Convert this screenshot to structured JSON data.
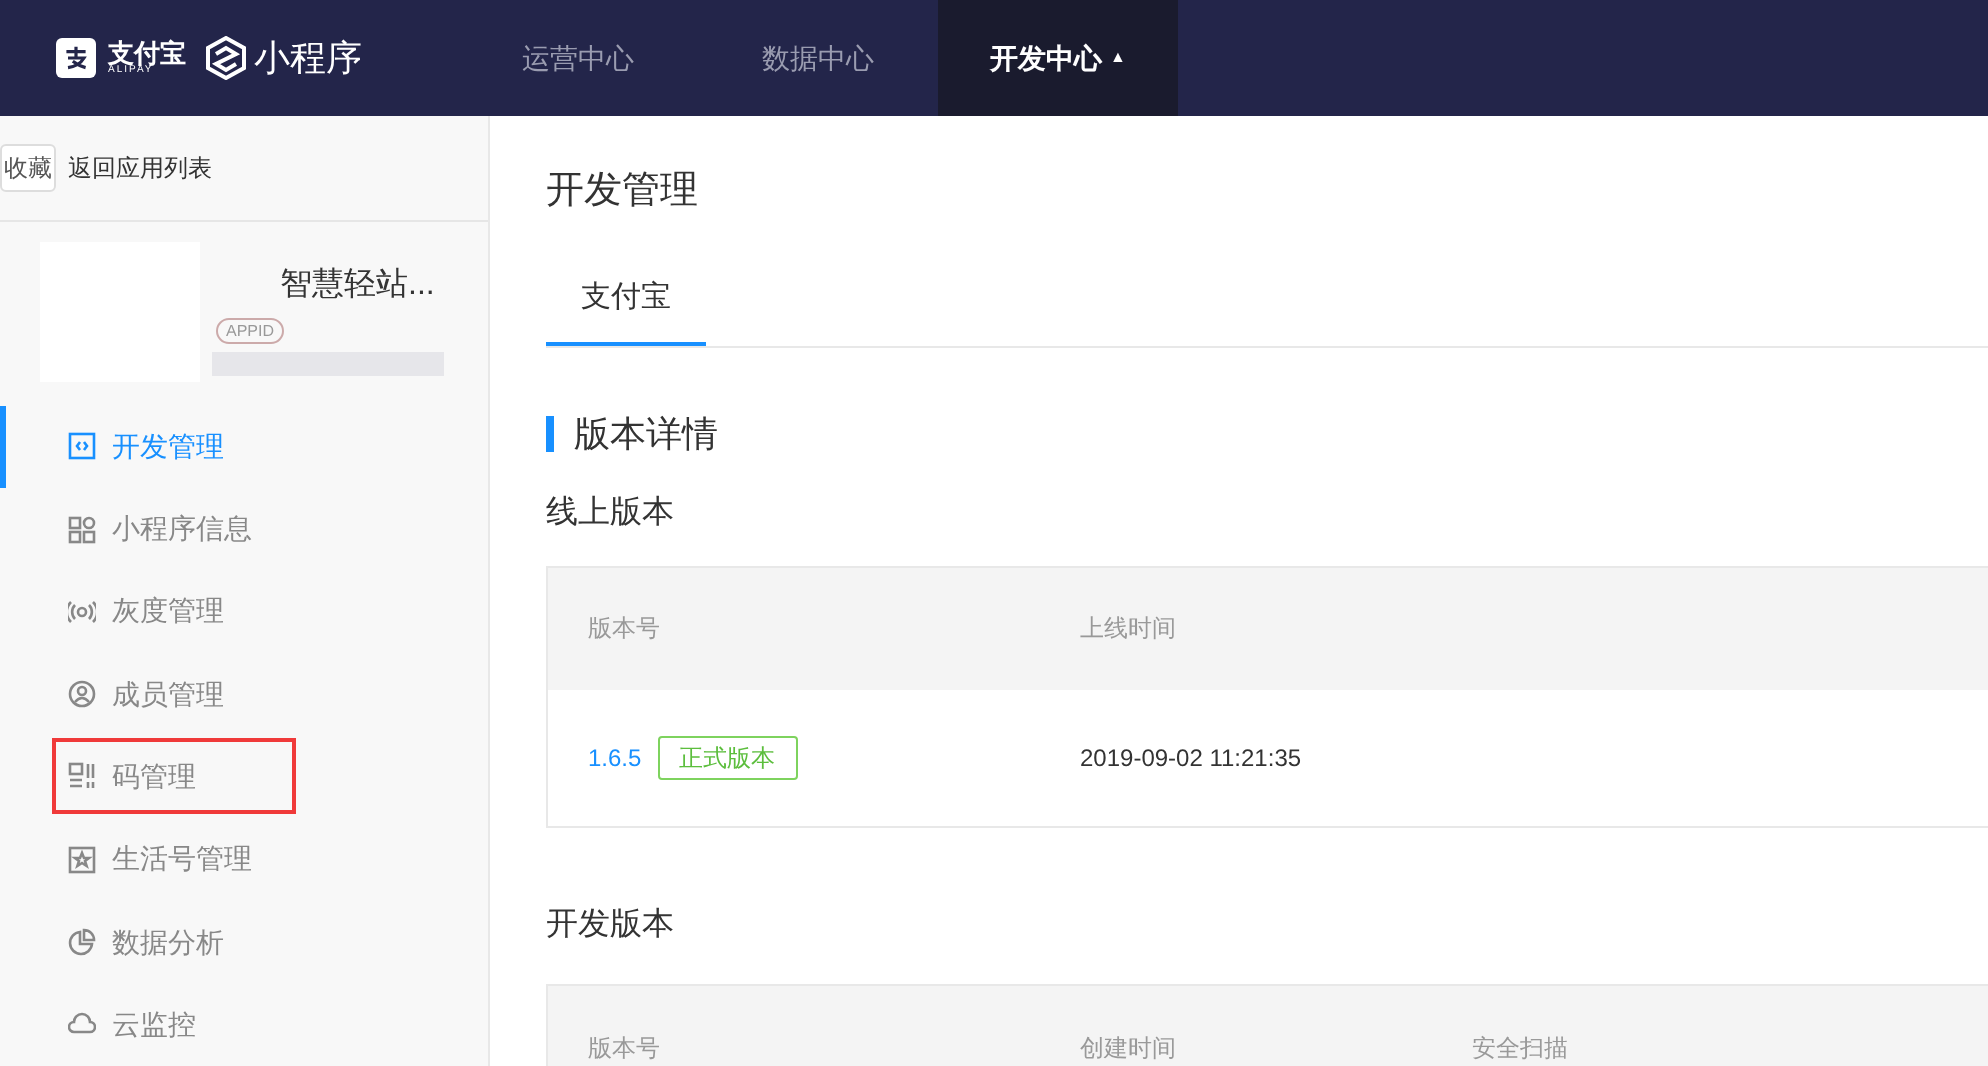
{
  "brand": {
    "alipay": "支付宝",
    "alipay_en": "ALIPAY",
    "product": "小程序"
  },
  "nav": [
    {
      "label": "运营中心",
      "selected": false
    },
    {
      "label": "数据中心",
      "selected": false
    },
    {
      "label": "开发中心",
      "selected": true,
      "caret": "▲"
    }
  ],
  "sidebar": {
    "favorite": "收藏",
    "back": "返回应用列表",
    "app_name": "智慧轻站...",
    "appid_badge": "APPID",
    "items": [
      {
        "label": "开发管理",
        "kind": "code",
        "selected": true,
        "highlighted": false
      },
      {
        "label": "小程序信息",
        "kind": "grid",
        "selected": false,
        "highlighted": false
      },
      {
        "label": "灰度管理",
        "kind": "signal",
        "selected": false,
        "highlighted": false
      },
      {
        "label": "成员管理",
        "kind": "user",
        "selected": false,
        "highlighted": false
      },
      {
        "label": "码管理",
        "kind": "scan",
        "selected": false,
        "highlighted": true
      },
      {
        "label": "生活号管理",
        "kind": "star",
        "selected": false,
        "highlighted": false
      },
      {
        "label": "数据分析",
        "kind": "pie",
        "selected": false,
        "highlighted": false
      },
      {
        "label": "云监控",
        "kind": "cloud",
        "selected": false,
        "highlighted": false
      }
    ]
  },
  "main": {
    "title": "开发管理",
    "tabs": [
      {
        "label": "支付宝",
        "selected": true
      }
    ],
    "section_title": "版本详情",
    "online": {
      "title": "线上版本",
      "columns": [
        "版本号",
        "上线时间"
      ],
      "rows": [
        {
          "version": "1.6.5",
          "tag": "正式版本",
          "time": "2019-09-02 11:21:35"
        }
      ]
    },
    "dev": {
      "title": "开发版本",
      "columns": [
        "版本号",
        "创建时间",
        "安全扫描"
      ]
    }
  }
}
